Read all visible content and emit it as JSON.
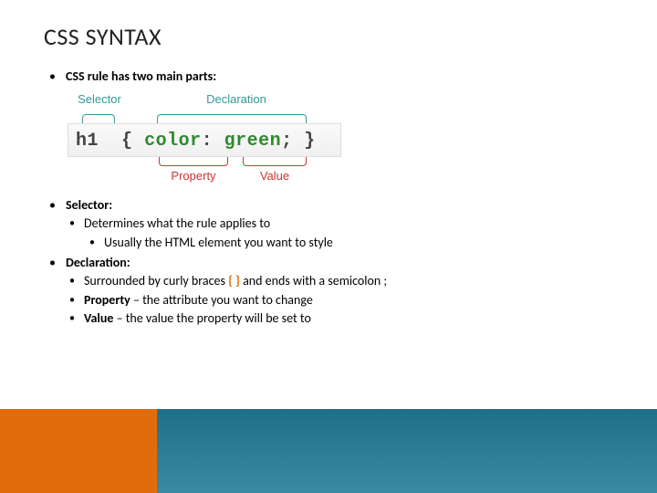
{
  "title": "CSS SYNTAX",
  "intro": "CSS rule has two main parts:",
  "diagram": {
    "top_labels": {
      "selector": "Selector",
      "declaration": "Declaration"
    },
    "code": {
      "tag": "h1",
      "open": "{",
      "prop": "color",
      "colon": ":",
      "value": "green",
      "semi": ";",
      "close": "}"
    },
    "bottom_labels": {
      "property": "Property",
      "value": "Value"
    }
  },
  "items": {
    "selector_h": "Selector:",
    "selector_1": "Determines what the rule applies to",
    "selector_1a": "Usually the HTML element you want to style",
    "declaration_h": "Declaration:",
    "decl_1_pre": "Surrounded by curly braces ",
    "decl_1_braces": "{ }",
    "decl_1_post": " and ends with a semicolon ;",
    "decl_2_pre": "Property",
    "decl_2_post": " – the attribute you want to change",
    "decl_3_pre": "Value",
    "decl_3_post": " – the value the property will be set to"
  },
  "colors": {
    "orange": "#e36c0a",
    "teal": "#2a7a96",
    "label_top": "#339999",
    "label_bot": "#cc3333"
  }
}
